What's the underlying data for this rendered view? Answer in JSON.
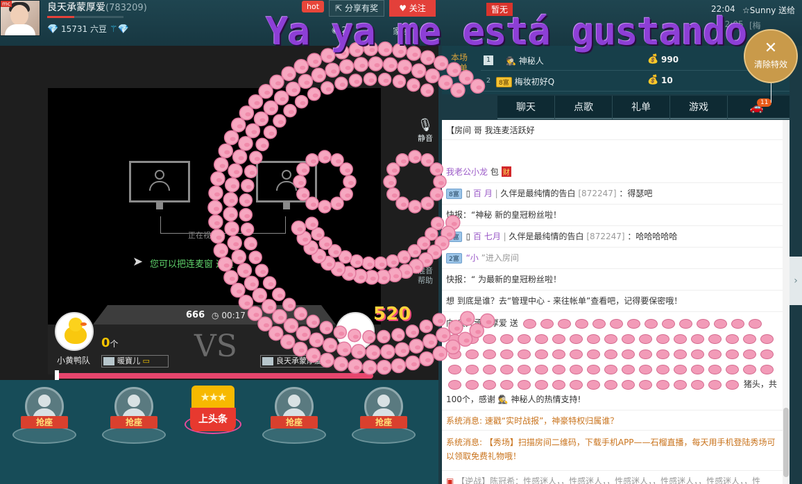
{
  "header": {
    "host_name": "良天承蒙厚爱",
    "host_id": "(783209)",
    "beans": "15731 六豆",
    "level_progress": 0.35,
    "hot_label": "hot",
    "share_label": "分享有奖",
    "follow_label": "关注",
    "audience_prefix": "20",
    "family_label": "家族",
    "avatar_badge": "mc"
  },
  "overlay": {
    "text": "Ya ya me está gustando",
    "number": "520"
  },
  "notices": [
    {
      "time": "22:04",
      "text": "☆Sunny 送给"
    },
    {
      "time": "22:05",
      "text": "[梅"
    }
  ],
  "status_tag": "暂无",
  "clear_effects_label": "清除特效",
  "video": {
    "connecting_text": "正在视",
    "drag_hint": "您可以把连麦窗      这里",
    "mic_label": "静音",
    "mixer_label": "混音\n帮助"
  },
  "pk": {
    "count": "666",
    "time": "00:17",
    "left_team": "小黄鸭队",
    "left_score": "0",
    "left_score_unit": "个",
    "vs": "VS",
    "left_user": "暖寶儿",
    "right_user": "良天承蒙厚爱",
    "progress": 1.0
  },
  "seats": {
    "grab_label": "抢座",
    "headline_label": "上头条",
    "headline_stars": "★★★"
  },
  "rank": {
    "label": "本场\n榜单",
    "rows": [
      {
        "rank": "1",
        "badge": "",
        "name": "神秘人",
        "score": "990"
      },
      {
        "rank": "2",
        "badge": "8富",
        "name": "梅妆初好Q",
        "score": "10"
      }
    ]
  },
  "tabs": [
    "聊天",
    "点歌",
    "礼单",
    "游戏"
  ],
  "car_badge": "11",
  "chat": {
    "msg1": "【房间        哥 我连麦活跃好",
    "msg2_name": "我老公小龙",
    "msg2_text": "包",
    "msg2_money": "财",
    "msg3_badge": "8富",
    "msg3_name": "百             月",
    "msg3_text": "久伴是最纯情的告白",
    "msg3_id": "[872247]",
    "msg3_content": "：得瑟吧",
    "msg4": "快报：“神秘           新的皇冠粉丝啦！",
    "msg5_badge": "8富",
    "msg5_name": "百             七月",
    "msg5_text": "久伴是最纯情的告白",
    "msg5_id": "[872247]",
    "msg5_content": "：哈哈哈哈哈",
    "msg6_badge": "2富",
    "msg6_name": "“小",
    "msg6_text": "”进入房间",
    "msg7": "快报：“           为最新的皇冠粉丝啦！",
    "msg8": "想         到底是谁？去“管理中心 - 来往帐单”查看吧，记得要保密哦！",
    "gift_prefix": "向",
    "gift_target": "良天承蒙厚爱",
    "gift_verb": "送",
    "gift_summary": "猪头，共100个，感谢 🕵 神秘人的热情支持!",
    "sys1": "系统消息: 速戳“实时战报”，神豪特权归属谁？",
    "sys2": "系统消息: 【秀场】扫描房间二维码，下载手机APP——石榴直播，每天用手机登陆秀场可以领取免费礼物哦！",
    "last": "【逆战】陈冠希：性感迷人，，性感迷人，，性感迷人，，性感迷人，，性感迷人，，性"
  }
}
